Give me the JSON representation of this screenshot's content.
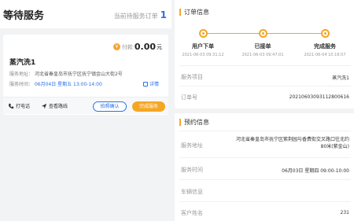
{
  "left": {
    "title": "等待服务",
    "pending_label": "当前待服务订单",
    "pending_count": "1"
  },
  "order_card": {
    "pay_label": "付款",
    "pay_amount": "0.00",
    "pay_unit": "元",
    "service_name": "蒸汽洗1",
    "address_label": "服务地址：",
    "address_value": "河北省秦皇岛市抚宁区抚宁镇金山大街2号",
    "time_label": "服务时间：",
    "time_value": "06月04日 星期五 13:00-14:00",
    "detail_link": "详情",
    "call_label": "打电话",
    "route_label": "查看路线",
    "confirm_label": "拍照确认",
    "done_label": "完成服务"
  },
  "order_info": {
    "title": "订单信息",
    "steps": [
      {
        "label": "用户下单",
        "time": "2021-06-03 09:31:12"
      },
      {
        "label": "已接单",
        "time": "2021-06-03 09:47:01"
      },
      {
        "label": "完成服务",
        "time": "2021-06-04 10:16:57"
      }
    ],
    "rows": [
      {
        "label": "服务项目",
        "value": "蒸汽洗1"
      },
      {
        "label": "订单号",
        "value": "20210603093112800616"
      }
    ]
  },
  "booking_info": {
    "title": "预约信息",
    "rows": [
      {
        "label": "服务地址",
        "value": "河北省秦皇岛市抚宁区紫荆园与香费街交叉路口往北约80米(紫金山)"
      },
      {
        "label": "服务时间",
        "value": "06月03日 星期四 09:00-10:00"
      },
      {
        "label": "车辆信息",
        "value": ""
      },
      {
        "label": "客户姓名",
        "value": "231"
      }
    ]
  },
  "colors": {
    "accent": "#f5a623",
    "link": "#2a72e8"
  }
}
